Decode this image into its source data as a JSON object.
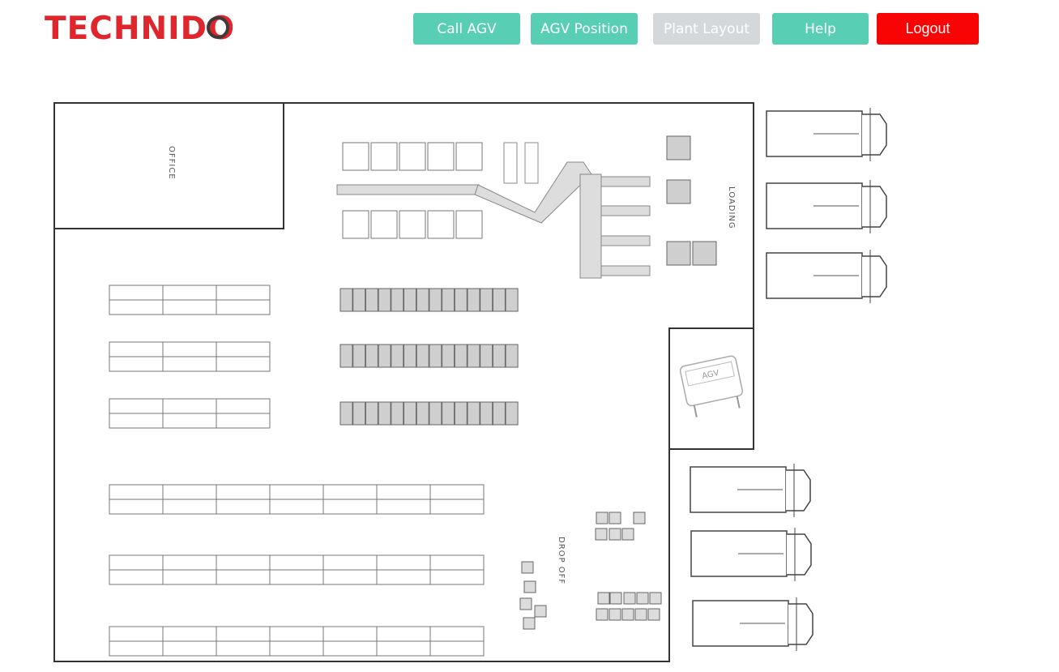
{
  "brand": {
    "name": "TECHNIDO"
  },
  "nav": {
    "call_agv": "Call AGV",
    "agv_position": "AGV Position",
    "plant_layout": "Plant Layout",
    "help": "Help",
    "logout": "Logout"
  },
  "plan": {
    "office": "OFFICE",
    "loading": "LOADING",
    "drop_off": "DROP OFF",
    "agv": "AGV"
  },
  "colors": {
    "accent": "#58cfb5",
    "disabled": "#d5d8db",
    "danger": "#f80404",
    "brand": "#e0262d"
  }
}
